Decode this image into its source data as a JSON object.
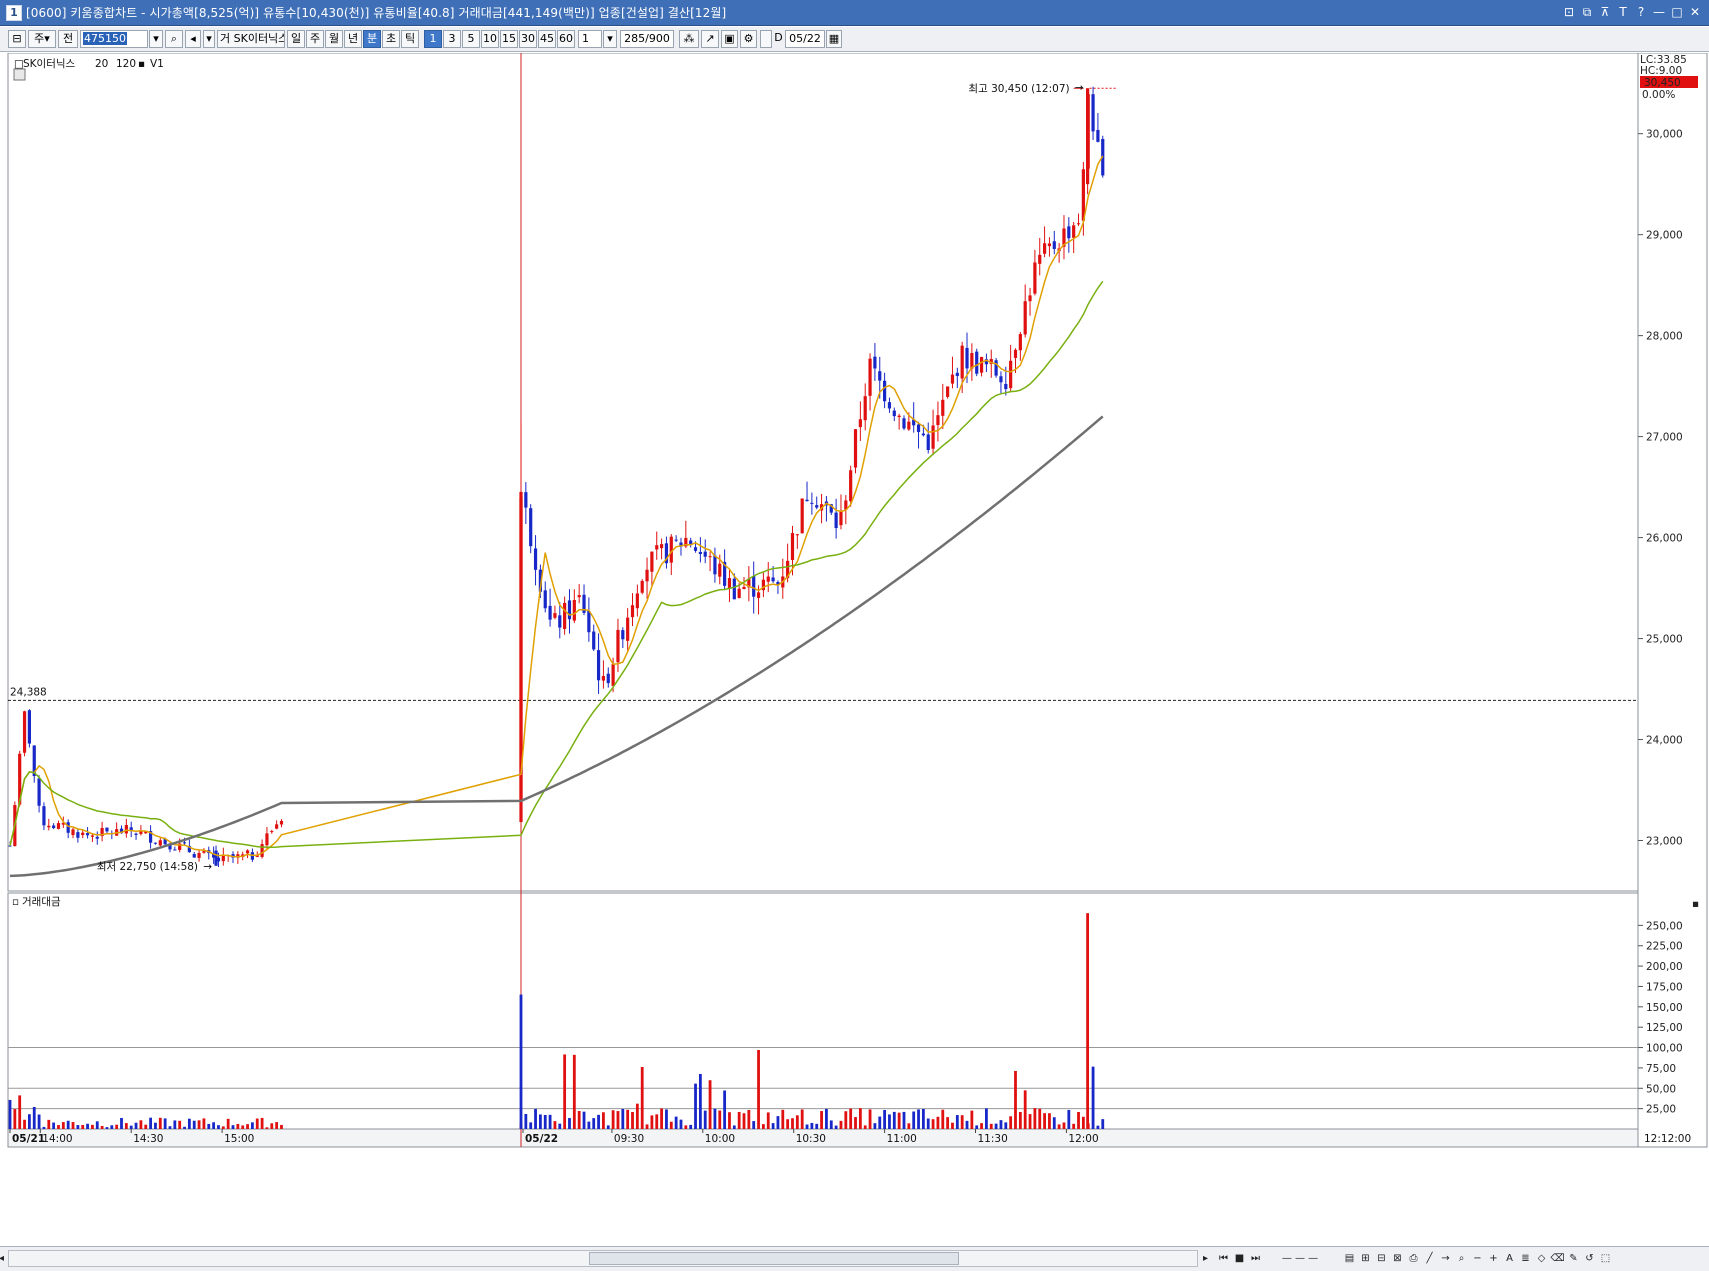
{
  "window": {
    "screen_no": "1",
    "title": "[0600] 키움종합차트 - 시가총액[8,525(억)] 유통수[10,430(천)] 유통비율[40.8] 거래대금[441,149(백만)] 업종[건설업] 결산[12월]",
    "controls": [
      "⊡",
      "⧉",
      "⊼",
      "T",
      "?",
      "—",
      "□",
      "✕"
    ]
  },
  "toolbar": {
    "type_select": "주",
    "scope_select": "전",
    "stock_code": "475150",
    "stock_name": "SK이터닉스",
    "search_prefix": "거",
    "periods": [
      "일",
      "주",
      "월",
      "년",
      "분",
      "초",
      "틱"
    ],
    "active_period": "분",
    "intervals": [
      "1",
      "3",
      "5",
      "10",
      "15",
      "30",
      "45",
      "60"
    ],
    "active_interval": "1",
    "interval_select": "1",
    "count": "285",
    "count_max": "/900",
    "d_label": "D",
    "date": "05/22"
  },
  "legend": {
    "stock": "SK이터닉스",
    "ma1": "20",
    "ma2": "120",
    "ma3": "V1"
  },
  "volume_panel": {
    "title": "거래대금"
  },
  "price_axis": {
    "top_labels": [
      "LC:33.85",
      "HC:9.00",
      "30,450",
      "0.00%"
    ],
    "ticks": [
      "30,000",
      "29,000",
      "28,000",
      "27,000",
      "26,000",
      "25,000",
      "24,000",
      "23,000"
    ]
  },
  "volume_axis": {
    "ticks": [
      "250,00",
      "225,00",
      "200,00",
      "175,00",
      "150,00",
      "125,00",
      "100,00",
      "75,00",
      "50,00",
      "25,00"
    ]
  },
  "annotations": {
    "high": "최고 30,450 (12:07)",
    "low": "최저 22,750 (14:58)",
    "ref_line_value": "24,388"
  },
  "time_axis": {
    "labels": [
      "05/21",
      "14:00",
      "14:30",
      "15:00",
      "05/22",
      "09:30",
      "10:00",
      "10:30",
      "11:00",
      "11:30",
      "12:00"
    ],
    "current_time": "12:12:00"
  },
  "colors": {
    "up": "#e01010",
    "down": "#1828c8",
    "ma20": "#e0a000",
    "ma120": "#78b010",
    "v1": "#707070",
    "title_bg": "#3f6fb7"
  },
  "chart_data": {
    "type": "candlestick",
    "interval": "1분",
    "x_range": [
      "05/21 13:50",
      "05/22 12:12"
    ],
    "y_range": [
      22500,
      30700
    ],
    "high": {
      "value": 30450,
      "time": "12:07"
    },
    "low": {
      "value": 22750,
      "time": "14:58"
    },
    "reference_line": 24388,
    "price_path": [
      {
        "t": "05/21 13:50",
        "close": 22950
      },
      {
        "t": "05/21 13:55",
        "close": 24300
      },
      {
        "t": "05/21 14:00",
        "close": 23200
      },
      {
        "t": "05/21 14:15",
        "close": 23050
      },
      {
        "t": "05/21 14:30",
        "close": 23100
      },
      {
        "t": "05/21 14:45",
        "close": 22950
      },
      {
        "t": "05/21 14:58",
        "close": 22800
      },
      {
        "t": "05/21 15:10",
        "close": 22850
      },
      {
        "t": "05/21 15:20",
        "close": 23250
      },
      {
        "t": "05/22 09:00",
        "close": 26450
      },
      {
        "t": "05/22 09:10",
        "close": 25100
      },
      {
        "t": "05/22 09:20",
        "close": 25400
      },
      {
        "t": "05/22 09:27",
        "close": 24500
      },
      {
        "t": "05/22 09:40",
        "close": 25700
      },
      {
        "t": "05/22 09:55",
        "close": 26000
      },
      {
        "t": "05/22 10:10",
        "close": 25500
      },
      {
        "t": "05/22 10:25",
        "close": 25550
      },
      {
        "t": "05/22 10:35",
        "close": 26500
      },
      {
        "t": "05/22 10:45",
        "close": 26100
      },
      {
        "t": "05/22 10:55",
        "close": 27700
      },
      {
        "t": "05/22 11:05",
        "close": 27200
      },
      {
        "t": "05/22 11:15",
        "close": 26950
      },
      {
        "t": "05/22 11:25",
        "close": 27800
      },
      {
        "t": "05/22 11:40",
        "close": 27600
      },
      {
        "t": "05/22 11:50",
        "close": 28700
      },
      {
        "t": "05/22 12:05",
        "close": 29200
      },
      {
        "t": "05/22 12:07",
        "close": 30450
      },
      {
        "t": "05/22 12:12",
        "close": 29500
      }
    ],
    "volume_peaks": [
      {
        "t": "05/22 09:00",
        "value": 165,
        "dir": "down"
      },
      {
        "t": "05/22 12:07",
        "value": 265,
        "dir": "up"
      }
    ]
  }
}
